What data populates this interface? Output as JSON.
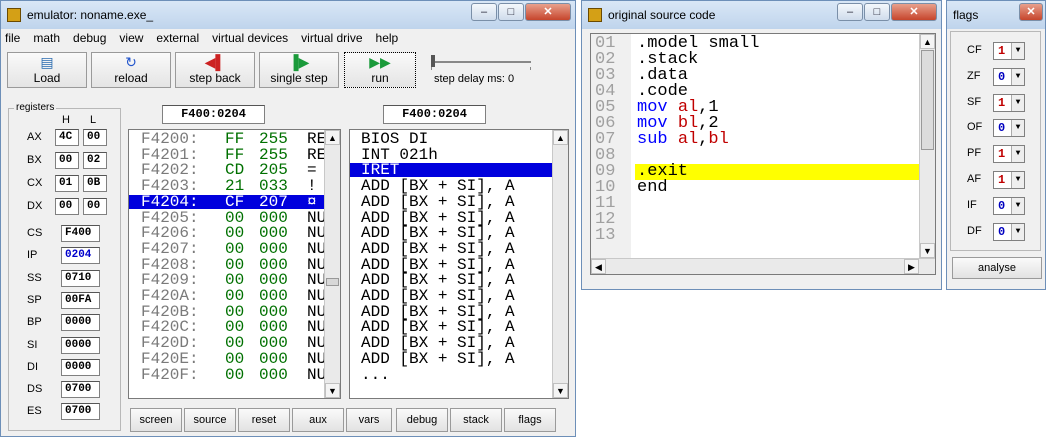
{
  "emulator": {
    "title": "emulator: noname.exe_",
    "menu": [
      "file",
      "math",
      "debug",
      "view",
      "external",
      "virtual devices",
      "virtual drive",
      "help"
    ],
    "toolbar": {
      "load": "Load",
      "reload": "reload",
      "step_back": "step back",
      "single_step": "single step",
      "run": "run",
      "step_delay": "step delay ms: 0"
    },
    "registers": {
      "group_label": "registers",
      "h_label": "H",
      "l_label": "L",
      "split": [
        {
          "name": "AX",
          "h": "4C",
          "l": "00"
        },
        {
          "name": "BX",
          "h": "00",
          "l": "02"
        },
        {
          "name": "CX",
          "h": "01",
          "l": "0B"
        },
        {
          "name": "DX",
          "h": "00",
          "l": "00"
        }
      ],
      "full": [
        {
          "name": "CS",
          "value": "F400",
          "blue": false
        },
        {
          "name": "IP",
          "value": "0204",
          "blue": true
        },
        {
          "name": "SS",
          "value": "0710",
          "blue": false
        },
        {
          "name": "SP",
          "value": "00FA",
          "blue": false
        },
        {
          "name": "BP",
          "value": "0000",
          "blue": false
        },
        {
          "name": "SI",
          "value": "0000",
          "blue": false
        },
        {
          "name": "DI",
          "value": "0000",
          "blue": false
        },
        {
          "name": "DS",
          "value": "0700",
          "blue": false
        },
        {
          "name": "ES",
          "value": "0700",
          "blue": false
        }
      ]
    },
    "memory": {
      "address": "F400:0204",
      "rows": [
        {
          "addr": "F4200:",
          "hex": "FF",
          "dec": "255",
          "ch": "RE",
          "sel": false
        },
        {
          "addr": "F4201:",
          "hex": "FF",
          "dec": "255",
          "ch": "RE",
          "sel": false
        },
        {
          "addr": "F4202:",
          "hex": "CD",
          "dec": "205",
          "ch": "=",
          "sel": false
        },
        {
          "addr": "F4203:",
          "hex": "21",
          "dec": "033",
          "ch": "!",
          "sel": false
        },
        {
          "addr": "F4204:",
          "hex": "CF",
          "dec": "207",
          "ch": "¤",
          "sel": true
        },
        {
          "addr": "F4205:",
          "hex": "00",
          "dec": "000",
          "ch": "NU",
          "sel": false
        },
        {
          "addr": "F4206:",
          "hex": "00",
          "dec": "000",
          "ch": "NU",
          "sel": false
        },
        {
          "addr": "F4207:",
          "hex": "00",
          "dec": "000",
          "ch": "NU",
          "sel": false
        },
        {
          "addr": "F4208:",
          "hex": "00",
          "dec": "000",
          "ch": "NU",
          "sel": false
        },
        {
          "addr": "F4209:",
          "hex": "00",
          "dec": "000",
          "ch": "NU",
          "sel": false
        },
        {
          "addr": "F420A:",
          "hex": "00",
          "dec": "000",
          "ch": "NU",
          "sel": false
        },
        {
          "addr": "F420B:",
          "hex": "00",
          "dec": "000",
          "ch": "NU",
          "sel": false
        },
        {
          "addr": "F420C:",
          "hex": "00",
          "dec": "000",
          "ch": "NU",
          "sel": false
        },
        {
          "addr": "F420D:",
          "hex": "00",
          "dec": "000",
          "ch": "NU",
          "sel": false
        },
        {
          "addr": "F420E:",
          "hex": "00",
          "dec": "000",
          "ch": "NU",
          "sel": false
        },
        {
          "addr": "F420F:",
          "hex": "00",
          "dec": "000",
          "ch": "NU",
          "sel": false
        }
      ]
    },
    "disasm": {
      "address": "F400:0204",
      "rows": [
        {
          "text": "BIOS DI",
          "sel": false
        },
        {
          "text": "INT 021h",
          "sel": false
        },
        {
          "text": "IRET",
          "sel": true
        },
        {
          "text": "ADD [BX + SI], A",
          "sel": false
        },
        {
          "text": "ADD [BX + SI], A",
          "sel": false
        },
        {
          "text": "ADD [BX + SI], A",
          "sel": false
        },
        {
          "text": "ADD [BX + SI], A",
          "sel": false
        },
        {
          "text": "ADD [BX + SI], A",
          "sel": false
        },
        {
          "text": "ADD [BX + SI], A",
          "sel": false
        },
        {
          "text": "ADD [BX + SI], A",
          "sel": false
        },
        {
          "text": "ADD [BX + SI], A",
          "sel": false
        },
        {
          "text": "ADD [BX + SI], A",
          "sel": false
        },
        {
          "text": "ADD [BX + SI], A",
          "sel": false
        },
        {
          "text": "ADD [BX + SI], A",
          "sel": false
        },
        {
          "text": "ADD [BX + SI], A",
          "sel": false
        },
        {
          "text": "..."
        }
      ]
    },
    "bottom_buttons": [
      "screen",
      "source",
      "reset",
      "aux",
      "vars",
      "debug",
      "stack",
      "flags"
    ]
  },
  "source": {
    "title": "original source code",
    "lines": [
      {
        "num": "01",
        "tokens": [
          {
            "t": ".model small",
            "c": "#000000"
          }
        ]
      },
      {
        "num": "02",
        "tokens": [
          {
            "t": ".stack",
            "c": "#000000"
          }
        ]
      },
      {
        "num": "03",
        "tokens": [
          {
            "t": ".data",
            "c": "#000000"
          }
        ]
      },
      {
        "num": "04",
        "tokens": [
          {
            "t": ".code",
            "c": "#000000"
          }
        ]
      },
      {
        "num": "05",
        "tokens": [
          {
            "t": "mov ",
            "c": "#0000ff"
          },
          {
            "t": "al",
            "c": "#c00000"
          },
          {
            "t": ",1",
            "c": "#000000"
          }
        ]
      },
      {
        "num": "06",
        "tokens": [
          {
            "t": "mov ",
            "c": "#0000ff"
          },
          {
            "t": "bl",
            "c": "#c00000"
          },
          {
            "t": ",2",
            "c": "#000000"
          }
        ]
      },
      {
        "num": "07",
        "tokens": [
          {
            "t": "sub ",
            "c": "#0000ff"
          },
          {
            "t": "al",
            "c": "#c00000"
          },
          {
            "t": ",",
            "c": "#000000"
          },
          {
            "t": "bl",
            "c": "#c00000"
          }
        ]
      },
      {
        "num": "08",
        "tokens": []
      },
      {
        "num": "09",
        "tokens": [
          {
            "t": ".exit",
            "c": "#000000"
          }
        ],
        "highlight": true
      },
      {
        "num": "10",
        "tokens": [
          {
            "t": "end",
            "c": "#000000"
          }
        ]
      },
      {
        "num": "11",
        "tokens": []
      },
      {
        "num": "12",
        "tokens": []
      },
      {
        "num": "13",
        "tokens": []
      }
    ],
    "highlight_color": "#ffff00"
  },
  "flags": {
    "title": "flags",
    "items": [
      {
        "name": "CF",
        "value": "1",
        "color": "#c00000"
      },
      {
        "name": "ZF",
        "value": "0",
        "color": "#0000c0"
      },
      {
        "name": "SF",
        "value": "1",
        "color": "#c00000"
      },
      {
        "name": "OF",
        "value": "0",
        "color": "#0000c0"
      },
      {
        "name": "PF",
        "value": "1",
        "color": "#c00000"
      },
      {
        "name": "AF",
        "value": "1",
        "color": "#c00000"
      },
      {
        "name": "IF",
        "value": "0",
        "color": "#0000c0"
      },
      {
        "name": "DF",
        "value": "0",
        "color": "#0000c0"
      }
    ],
    "analyse": "analyse"
  },
  "colors": {
    "selection": "#0000dd",
    "hex_green": "#007000",
    "title_grad": "#c6d8ee"
  },
  "icons": {
    "load": "load-icon",
    "reload": "reload-icon",
    "step_back": "step-back-icon",
    "single_step": "single-step-icon",
    "run": "run-icon",
    "minimize": "minimize-icon",
    "maximize": "maximize-icon",
    "close": "close-icon"
  }
}
